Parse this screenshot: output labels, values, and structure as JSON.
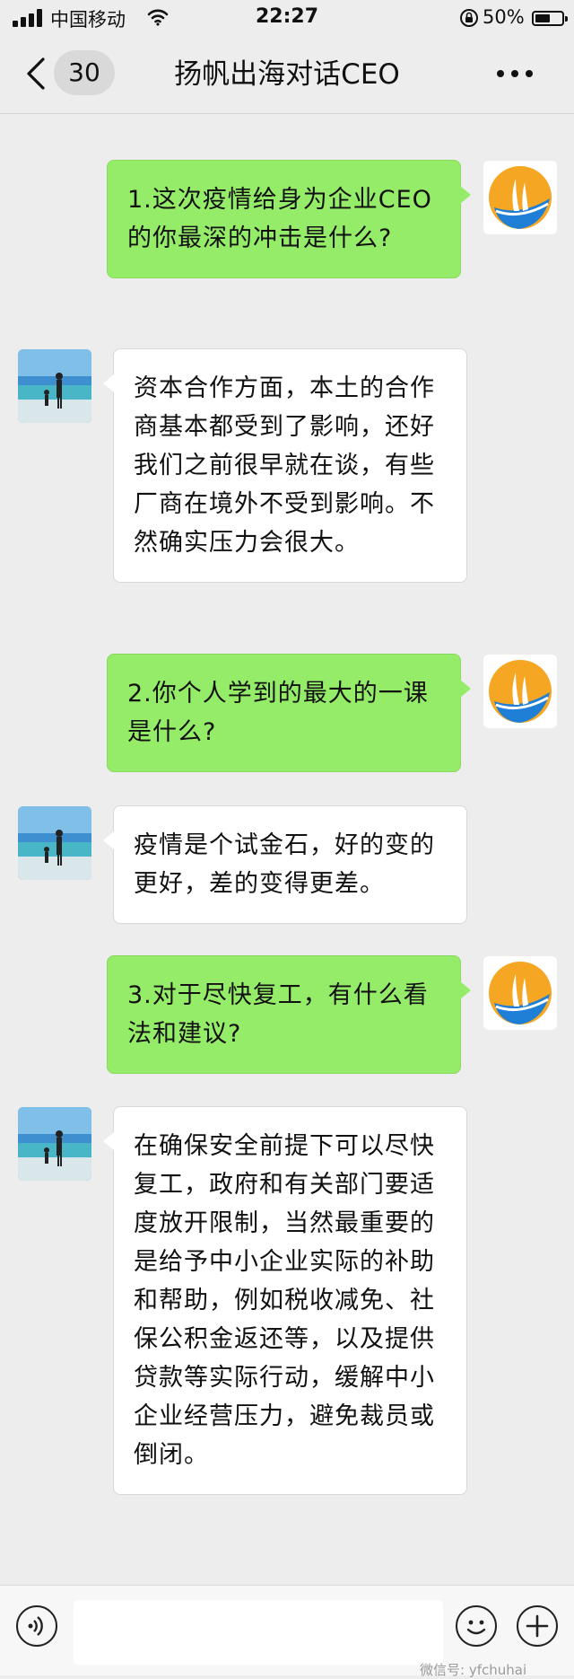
{
  "status_bar": {
    "carrier": "中国移动",
    "time": "22:27",
    "battery_percent": "50%",
    "icons": [
      "signal-icon",
      "wifi-icon",
      "rotation-lock-icon",
      "battery-icon"
    ]
  },
  "nav": {
    "unread_count": "30",
    "title": "扬帆出海对话CEO",
    "icons": [
      "back-chevron-icon",
      "more-icon"
    ]
  },
  "messages": [
    {
      "side": "right",
      "sender": "logo",
      "text": "1.这次疫情给身为企业CEO的你最深的冲击是什么?"
    },
    {
      "side": "left",
      "sender": "beach",
      "text": "资本合作方面，本土的合作商基本都受到了影响，还好我们之前很早就在谈，有些厂商在境外不受到影响。不然确实压力会很大。"
    },
    {
      "side": "right",
      "sender": "logo",
      "text": "2.你个人学到的最大的一课是什么?"
    },
    {
      "side": "left",
      "sender": "beach",
      "text": "疫情是个试金石，好的变的更好，差的变得更差。"
    },
    {
      "side": "right",
      "sender": "logo",
      "text": "3.对于尽快复工，有什么看法和建议?"
    },
    {
      "side": "left",
      "sender": "beach",
      "text": "在确保安全前提下可以尽快复工，政府和有关部门要适度放开限制，当然最重要的是给予中小企业实际的补助和帮助，例如税收减免、社保公积金返还等，以及提供贷款等实际行动，缓解中小企业经营压力，避免裁员或倒闭。"
    }
  ],
  "input_bar": {
    "icons": [
      "voice-icon",
      "emoji-icon",
      "plus-icon"
    ]
  },
  "watermark": "微信号: yfchuhai",
  "colors": {
    "background": "#ededed",
    "bubble_outgoing": "#95ec69",
    "bubble_incoming": "#ffffff"
  }
}
